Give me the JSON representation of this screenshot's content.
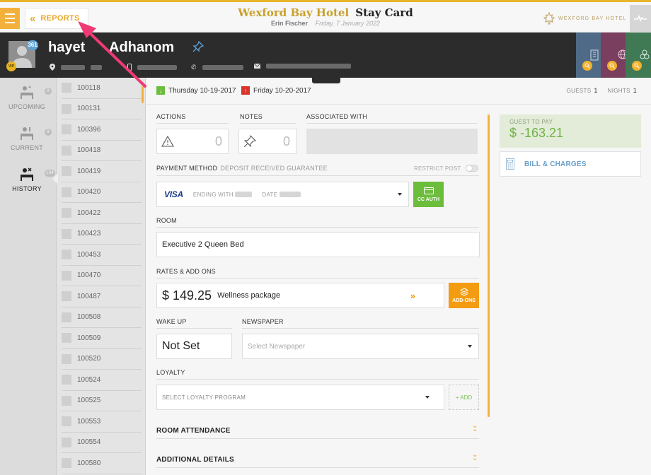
{
  "topbar": {
    "reports_label": "REPORTS",
    "hotel_name": "Wexford Bay Hotel",
    "page_title": "Stay Card",
    "user_name": "Erin Fischer",
    "business_date": "Friday, 7 January 2022",
    "brand_logo_text": "WEXFORD BAY HOTEL",
    "colors": {
      "accent": "#f3b13c",
      "brand_gold": "#c8a02a"
    }
  },
  "guest": {
    "first_name": "hayet",
    "last_name": "Adhanom",
    "avatar_badge_count": "361",
    "vip_label": "VIP"
  },
  "nav": {
    "upcoming": {
      "label": "UPCOMING",
      "count": "0"
    },
    "current": {
      "label": "CURRENT",
      "count": "0"
    },
    "history": {
      "label": "HISTORY",
      "count": "134"
    }
  },
  "rooms": [
    "100118",
    "100131",
    "100396",
    "100418",
    "100419",
    "100420",
    "100422",
    "100423",
    "100453",
    "100470",
    "100487",
    "100508",
    "100509",
    "100520",
    "100524",
    "100525",
    "100553",
    "100554",
    "100580"
  ],
  "stay": {
    "arrival": "Thursday 10-19-2017",
    "departure": "Friday 10-20-2017",
    "guests_label": "GUESTS",
    "guests": "1",
    "nights_label": "NIGHTS",
    "nights": "1"
  },
  "sections": {
    "actions_label": "ACTIONS",
    "actions_count": "0",
    "notes_label": "NOTES",
    "notes_count": "0",
    "associated_label": "ASSOCIATED WITH",
    "payment_label": "PAYMENT METHOD",
    "payment_sub": "DEPOSIT RECEIVED GUARANTEE",
    "restrict_post": "RESTRICT POST",
    "card_brand": "VISA",
    "ending_with": "ENDING WITH",
    "date_label": "DATE",
    "cc_auth": "CC AUTH",
    "room_label": "ROOM",
    "room_type": "Executive 2 Queen Bed",
    "rates_label": "RATES & ADD ONS",
    "rate_amount": "$ 149.25",
    "rate_package": "Wellness package",
    "addons_btn": "ADD-ONS",
    "wakeup_label": "WAKE UP",
    "wakeup_value": "Not Set",
    "newspaper_label": "NEWSPAPER",
    "newspaper_placeholder": "Select Newspaper",
    "loyalty_label": "LOYALTY",
    "loyalty_placeholder": "SELECT LOYALTY PROGRAM",
    "add_loyalty": "+ ADD",
    "room_attendance": "ROOM ATTENDANCE",
    "additional_details": "ADDITIONAL DETAILS"
  },
  "billing": {
    "guest_to_pay_label": "GUEST TO PAY",
    "guest_to_pay_value": "$ -163.21",
    "bill_label": "BILL & CHARGES"
  }
}
